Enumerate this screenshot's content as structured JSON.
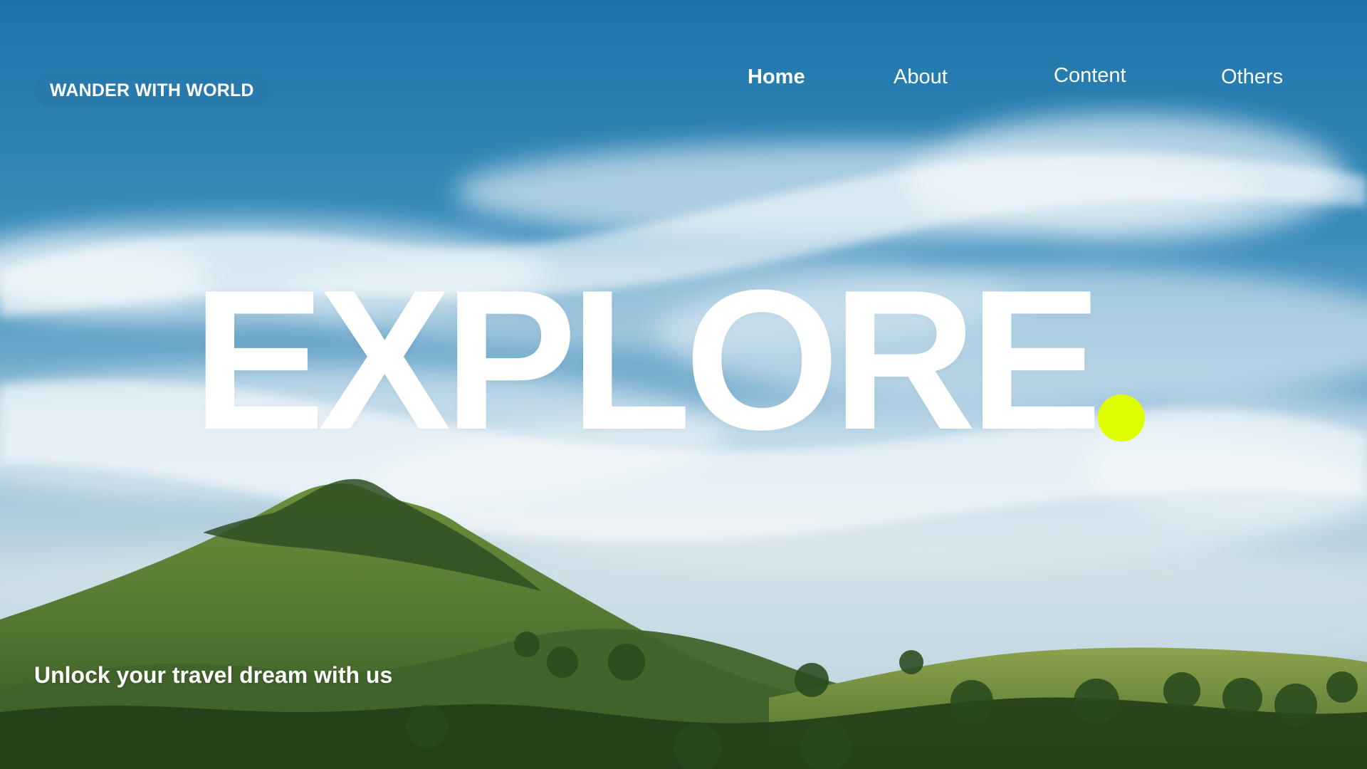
{
  "brand": {
    "name": "WANDER WITH WORLD"
  },
  "nav": {
    "items": [
      {
        "label": "Home",
        "active": true
      },
      {
        "label": "About",
        "active": false
      },
      {
        "label": "Content",
        "active": false
      },
      {
        "label": "Others",
        "active": false
      }
    ]
  },
  "hero": {
    "headline": "EXPLORE",
    "tagline": "Unlock your travel dream with us"
  },
  "colors": {
    "accent": "#dfff00",
    "sky": "#1f78ab",
    "text": "#ffffff"
  }
}
